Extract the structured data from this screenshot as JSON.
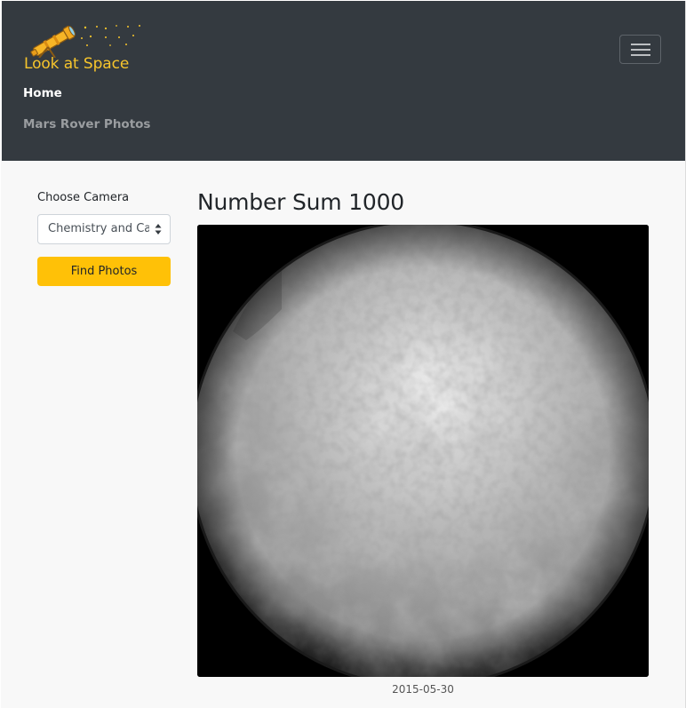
{
  "navbar": {
    "brand": "Look at Space",
    "links": [
      "Home",
      "Mars Rover Photos"
    ],
    "menu_icon": "hamburger-menu-icon"
  },
  "sidebar": {
    "camera_label": "Choose Camera",
    "camera_selected": "Chemistry and Camera Complex",
    "find_button": "Find Photos"
  },
  "main": {
    "title": "Number Sum 1000",
    "photo_date": "2015-05-30"
  },
  "colors": {
    "navbar": "#343a40",
    "brand": "#f7c52c",
    "accent": "#ffc107",
    "page": "#f8f8f8"
  },
  "icons": {
    "logo": "telescope-icon",
    "select": "sort-arrows-icon"
  }
}
